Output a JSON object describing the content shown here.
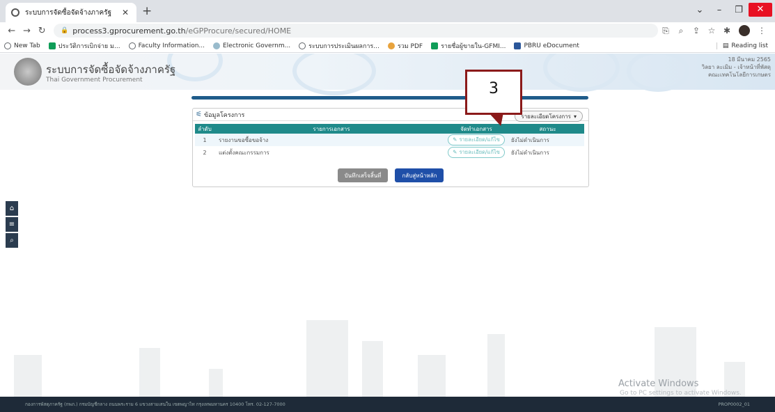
{
  "browser": {
    "tab_title": "ระบบการจัดซื้อจัดจ้างภาครัฐ",
    "url_host": "process3.gprocurement.go.th",
    "url_path": "/eGPProcure/secured/HOME",
    "bookmarks": [
      {
        "label": "New Tab",
        "icon": "globe-icon",
        "color": "#5f6368"
      },
      {
        "label": "ประวัติการเบิกจ่าย ม...",
        "icon": "sheets-icon",
        "color": "#0f9d58"
      },
      {
        "label": "Faculty Information...",
        "icon": "globe-icon",
        "color": "#5f6368"
      },
      {
        "label": "Electronic Governm...",
        "icon": "leaf-icon",
        "color": "#9bc"
      },
      {
        "label": "ระบบการประเมินผลการ...",
        "icon": "globe-icon",
        "color": "#5f6368"
      },
      {
        "label": "รวม PDF",
        "icon": "dots-icon",
        "color": "#e8a33d"
      },
      {
        "label": "รายชื่อผู้ขายใน-GFMI...",
        "icon": "sheets-icon",
        "color": "#0f9d58"
      },
      {
        "label": "PBRU eDocument",
        "icon": "doc-icon",
        "color": "#2b579a"
      }
    ],
    "reading_list": "Reading list"
  },
  "header": {
    "site_title": "ระบบการจัดซื้อจัดจ้างภาครัฐ",
    "site_subtitle": "Thai Government Procurement",
    "date": "18 มีนาคม 2565",
    "user_line": "วิลยา ละเมิม - เจ้าหน้าที่พัสดุ",
    "org_line": "คณะเทคโนโลยีการเกษตร"
  },
  "panel": {
    "title": "ข้อมูลโครงการ",
    "detail_button": "รายละเอียดโครงการ",
    "columns": [
      "ลำดับ",
      "รายการเอกสาร",
      "จัดทำเอกสาร",
      "สถานะ"
    ],
    "rows": [
      {
        "num": "1",
        "name": "รายงานขอซื้อขอจ้าง",
        "action": "รายละเอียด/แก้ไข",
        "status": "ยังไม่ดำเนินการ"
      },
      {
        "num": "2",
        "name": "แต่งตั้งคณะกรรมการ",
        "action": "รายละเอียด/แก้ไข",
        "status": "ยังไม่ดำเนินการ"
      }
    ],
    "save_button": "บันทึกเสร็จสิ้นที่",
    "home_button": "กลับสู่หน้าหลัก"
  },
  "callout_number": "3",
  "sidebar": {
    "items": [
      "home-icon",
      "menu-icon",
      "search-icon"
    ]
  },
  "watermark": {
    "title": "Activate Windows",
    "subtitle": "Go to PC settings to activate Windows."
  },
  "footer": {
    "address": "กองการพัสดุภาครัฐ (กพภ.) กรมบัญชีกลาง ถนนพระราม 6 แขวงสามเสนใน เขตพญาไท กรุงเทพมหานคร 10400 โทร. 02-127-7000",
    "code": "PROP0002_01"
  }
}
